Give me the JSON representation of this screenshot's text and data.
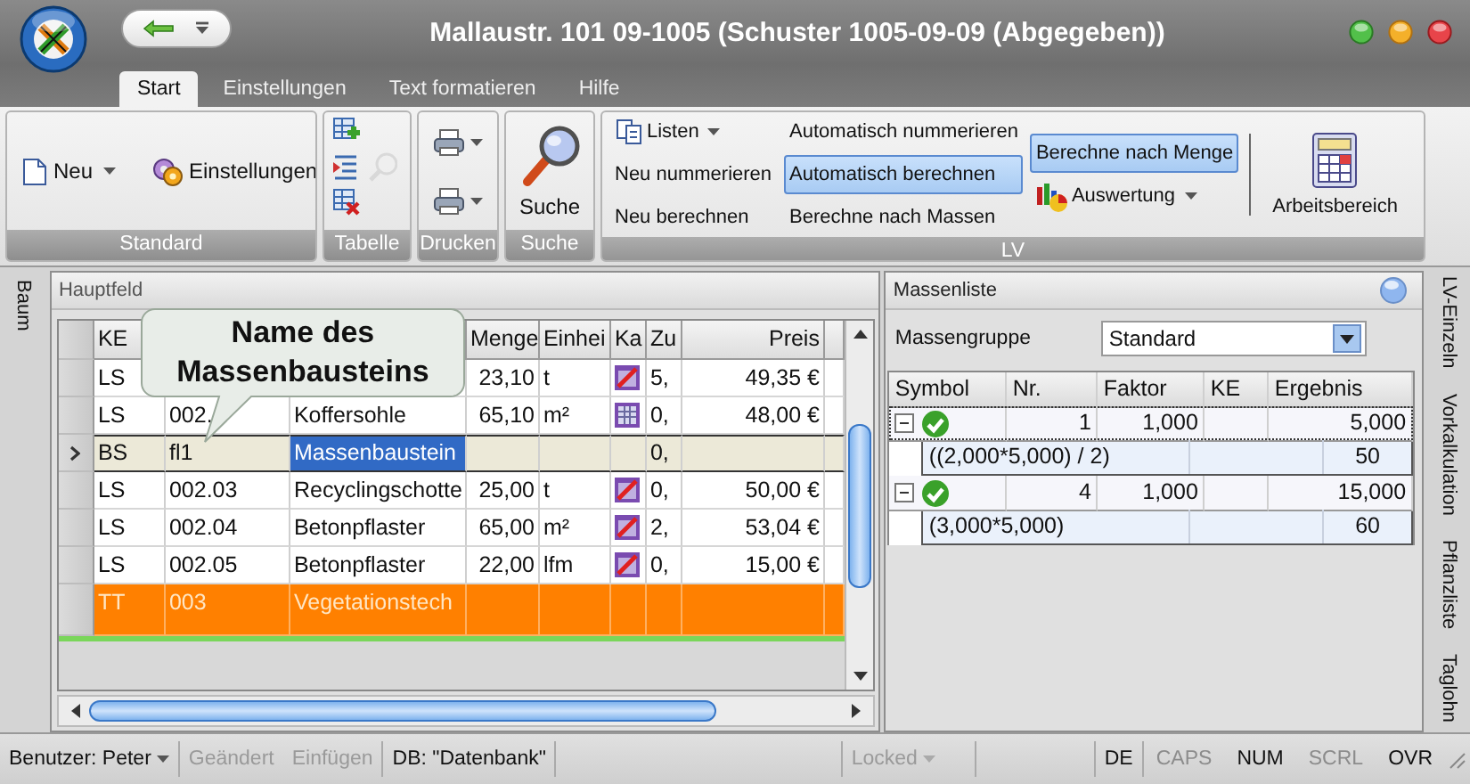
{
  "window": {
    "title": "Mallaustr. 101 09-1005 (Schuster 1005-09-09 (Abgegeben))"
  },
  "ribbon_tabs": [
    {
      "label": "Start",
      "selected": true
    },
    {
      "label": "Einstellungen",
      "selected": false
    },
    {
      "label": "Text formatieren",
      "selected": false
    },
    {
      "label": "Hilfe",
      "selected": false
    }
  ],
  "ribbon_groups": [
    {
      "label": "Standard",
      "buttons": [
        {
          "label": "Neu"
        },
        {
          "label": "Einstellungen"
        }
      ]
    },
    {
      "label": "Tabelle",
      "tools": [
        {
          "disabled": false
        },
        {
          "disabled": false
        },
        {
          "disabled": true
        },
        {
          "disabled": false
        }
      ]
    },
    {
      "label": "Drucken"
    },
    {
      "label": "Suche",
      "buttons": [
        {
          "label": "Suche"
        }
      ]
    },
    {
      "label": "LV",
      "columns": [
        [
          {
            "kind": "dropdown",
            "label": "Listen"
          },
          {
            "kind": "command",
            "label": "Neu nummerieren"
          },
          {
            "kind": "command",
            "label": "Neu berechnen"
          }
        ],
        [
          {
            "kind": "toggle",
            "label": "Automatisch nummerieren",
            "selected": false
          },
          {
            "kind": "toggle",
            "label": "Automatisch berechnen",
            "selected": true
          },
          {
            "kind": "toggle",
            "label": "Berechne nach Massen",
            "selected": false
          }
        ],
        [
          {
            "kind": "toggle",
            "label": "Berechne nach Menge",
            "selected": true
          },
          {
            "kind": "dropdown",
            "label": "Auswertung"
          }
        ]
      ],
      "large_button": {
        "label": "Arbeitsbereich"
      }
    }
  ],
  "left_tabs": [
    {
      "label": "Baum"
    }
  ],
  "hauptfeld": {
    "title": "Hauptfeld",
    "columns": [
      {
        "label": "KE"
      },
      {},
      {},
      {
        "label": "Menge"
      },
      {
        "label": "Einhei"
      },
      {
        "label": "Ka"
      },
      {
        "label": "Zu"
      },
      {
        "label": "Preis"
      }
    ],
    "rows": [
      {
        "kind": "item",
        "selected": false,
        "ke": "LS",
        "menge": "23,10",
        "einheit": "t",
        "ka": {
          "kind": "crossed"
        },
        "zu": "5,",
        "preis": "49,35 €"
      },
      {
        "kind": "item",
        "selected": false,
        "ke": "LS",
        "nr": "002.",
        "name": "Koffersohle",
        "menge": "65,10",
        "einheit": "m²",
        "ka": {
          "kind": "calculator"
        },
        "zu": "0,",
        "preis": "48,00 €"
      },
      {
        "kind": "block",
        "selected": true,
        "ke": "BS",
        "nr": "fl1",
        "name": "Massenbaustein",
        "zu": "0,"
      },
      {
        "kind": "item",
        "selected": false,
        "ke": "LS",
        "nr": "002.03",
        "name": "Recyclingschotte",
        "menge": "25,00",
        "einheit": "t",
        "ka": {
          "kind": "crossed"
        },
        "zu": "0,",
        "preis": "50,00 €"
      },
      {
        "kind": "item",
        "selected": false,
        "ke": "LS",
        "nr": "002.04",
        "name": "Betonpflaster",
        "menge": "65,00",
        "einheit": "m²",
        "ka": {
          "kind": "crossed"
        },
        "zu": "2,",
        "preis": "53,04 €"
      },
      {
        "kind": "item",
        "selected": false,
        "ke": "LS",
        "nr": "002.05",
        "name": "Betonpflaster",
        "menge": "22,00",
        "einheit": "lfm",
        "ka": {
          "kind": "crossed"
        },
        "zu": "0,",
        "preis": "15,00 €"
      },
      {
        "kind": "title",
        "selected": false,
        "ke": "TT",
        "nr": "003",
        "name": "Vegetationstech"
      }
    ],
    "callout": {
      "text": "Name des Massenbausteins"
    }
  },
  "massenliste": {
    "title": "Massenliste",
    "group_label": "Massengruppe",
    "group_value": "Standard",
    "columns": [
      "Symbol",
      "Nr.",
      "Faktor",
      "KE",
      "Ergebnis"
    ],
    "entries": [
      {
        "expanded": true,
        "nr": "1",
        "faktor": "1,000",
        "ergebnis": "5,000",
        "formula": "((2,000*5,000) / 2)",
        "formula_result": "50"
      },
      {
        "expanded": true,
        "nr": "4",
        "faktor": "1,000",
        "ergebnis": "15,000",
        "formula": "(3,000*5,000)",
        "formula_result": "60"
      }
    ]
  },
  "right_tabs": [
    {
      "label": "LV-Einzeln"
    },
    {
      "label": "Vorkalkulation"
    },
    {
      "label": "Pflanzliste"
    },
    {
      "label": "Taglohn"
    }
  ],
  "status_bar": {
    "left": [
      {
        "kind": "dropdown",
        "text": "Benutzer: Peter",
        "disabled": false
      },
      {
        "kind": "flag",
        "text": "Geändert",
        "disabled": true
      },
      {
        "kind": "flag",
        "text": "Einfügen",
        "disabled": true
      },
      {
        "kind": "text",
        "text": "DB: \"Datenbank\"",
        "disabled": false
      }
    ],
    "right": [
      {
        "kind": "dropdown",
        "text": "Locked",
        "disabled": true
      },
      {
        "kind": "text",
        "text": "DE",
        "disabled": false
      }
    ],
    "indicators": [
      {
        "text": "CAPS",
        "on": false
      },
      {
        "text": "NUM",
        "on": true
      },
      {
        "text": "SCRL",
        "on": false
      },
      {
        "text": "OVR",
        "on": true
      }
    ]
  }
}
